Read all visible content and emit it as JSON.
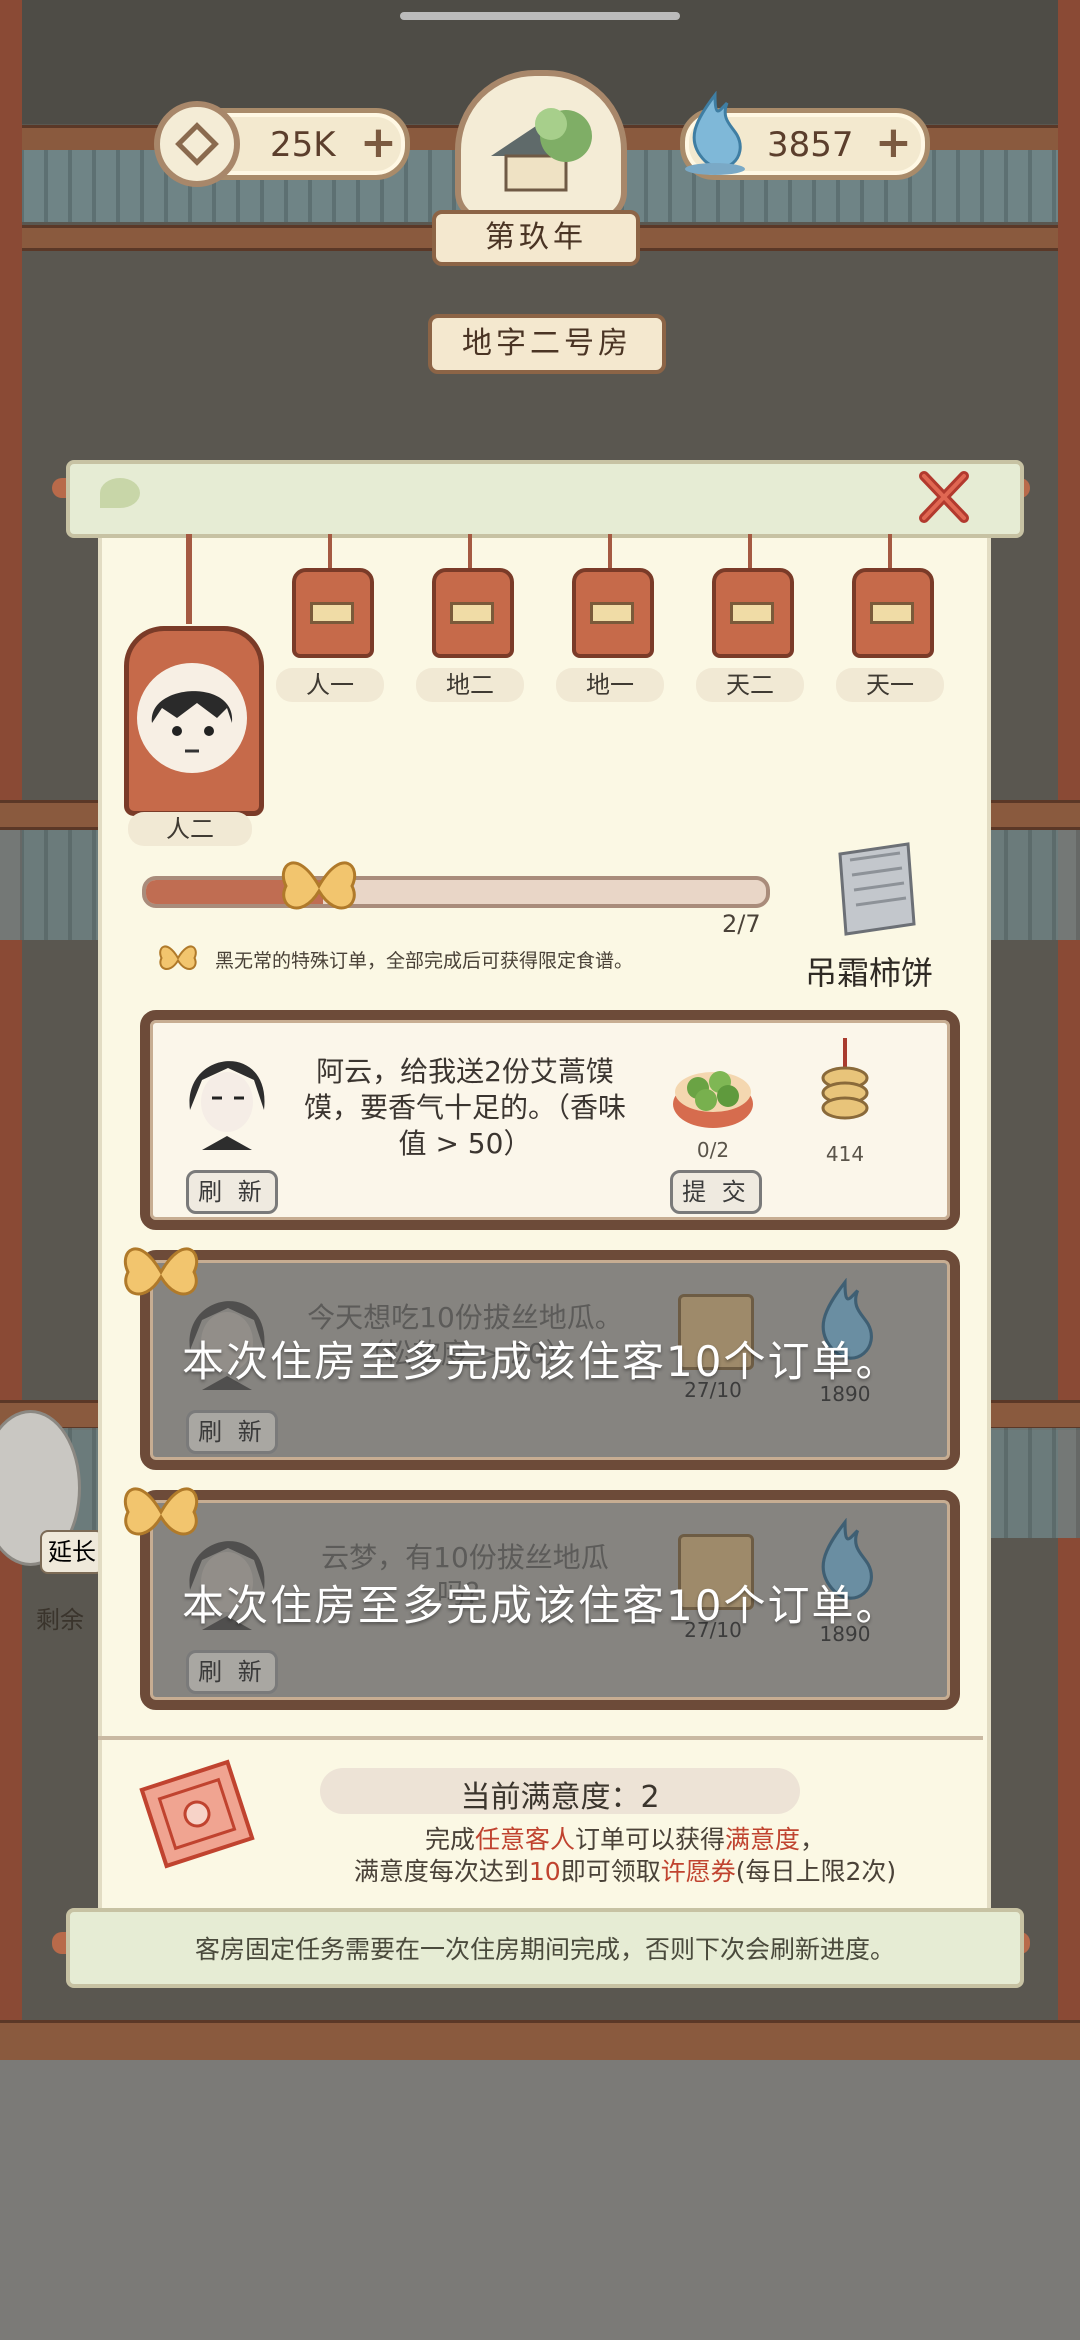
{
  "hud": {
    "coins": "25K",
    "jade": "3857",
    "year_label": "第玖年",
    "room_label": "地字二号房"
  },
  "task": {
    "current_rank": "人二",
    "ranks": [
      "人一",
      "地二",
      "地一",
      "天二",
      "天一"
    ],
    "progress_text": "2/7",
    "progress_fraction": 0.286,
    "special_note": "黑无常的特殊订单，全部完成后可获得限定食谱。",
    "reward_name": "吊霜柿饼"
  },
  "orders": [
    {
      "request": "阿云，给我送2份艾蒿馍馍，要香气十足的。（香味值 > 50）",
      "item_count": "0/2",
      "reward_amount": "414",
      "refresh_label": "刷 新",
      "submit_label": "提 交",
      "dimmed": false
    },
    {
      "request": "今天想吃10份拔丝地瓜。（松软度 > 20）",
      "item_count": "27/10",
      "reward_amount": "1890",
      "refresh_label": "刷 新",
      "toast": "本次住房至多完成该住客10个订单。",
      "dimmed": true
    },
    {
      "request": "云梦，有10份拔丝地瓜吗？",
      "item_count": "27/10",
      "reward_amount": "1890",
      "refresh_label": "刷 新",
      "toast": "本次住房至多完成该住客10个订单。",
      "dimmed": true
    }
  ],
  "satisfaction": {
    "title": "当前满意度：2",
    "line1_a": "完成",
    "line1_b": "任意客人",
    "line1_c": "订单可以获得",
    "line1_d": "满意度",
    "line1_e": "，",
    "line2_a": "满意度每次达到",
    "line2_b": "10",
    "line2_c": "即可领取",
    "line2_d": "许愿券",
    "line2_e": "(每日上限2次)"
  },
  "footer_note": "客房固定任务需要在一次住房期间完成，否则下次会刷新进度。",
  "side_labels": {
    "extend": "延长",
    "remaining": "剩余"
  },
  "colors": {
    "accent_red": "#c0432f",
    "card_border": "#6d4b39",
    "panel_bg": "#fbf8e4"
  }
}
